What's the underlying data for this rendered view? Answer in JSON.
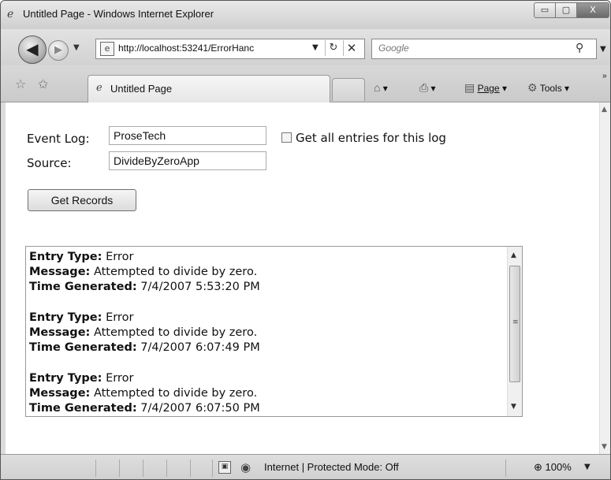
{
  "window": {
    "title": "Untitled Page - Windows Internet Explorer",
    "min_glyph": "▭",
    "max_glyph": "▢",
    "close_glyph": "X"
  },
  "nav": {
    "back_glyph": "◀",
    "forward_glyph": "▶",
    "address": "http://localhost:53241/ErrorHanc",
    "search_placeholder": "Google"
  },
  "tabs": {
    "active_label": "Untitled Page"
  },
  "commands": {
    "page_label": "Page",
    "tools_label": "Tools",
    "more_glyph": "»"
  },
  "form": {
    "event_log_label": "Event Log:",
    "event_log_value": "ProseTech",
    "source_label": "Source:",
    "source_value": "DivideByZeroApp",
    "get_all_label": "Get all entries for this log",
    "get_all_checked": false,
    "button_label": "Get Records"
  },
  "entries": [
    {
      "type_label": "Entry Type:",
      "type": "Error",
      "message_label": "Message:",
      "message": "Attempted to divide by zero.",
      "time_label": "Time Generated:",
      "time": "7/4/2007 5:53:20 PM"
    },
    {
      "type_label": "Entry Type:",
      "type": "Error",
      "message_label": "Message:",
      "message": "Attempted to divide by zero.",
      "time_label": "Time Generated:",
      "time": "7/4/2007 6:07:49 PM"
    },
    {
      "type_label": "Entry Type:",
      "type": "Error",
      "message_label": "Message:",
      "message": "Attempted to divide by zero.",
      "time_label": "Time Generated:",
      "time": "7/4/2007 6:07:50 PM"
    }
  ],
  "status": {
    "zone": "Internet | Protected Mode: Off",
    "zoom": "100%"
  },
  "icons": {
    "ie": "ie-logo-icon",
    "refresh": "refresh-icon",
    "stop": "stop-icon",
    "search": "search-icon",
    "home": "home-icon",
    "print": "print-icon",
    "page": "page-icon",
    "tools": "gear-icon",
    "favorites": "star-icon",
    "add_favorite": "add-favorite-icon",
    "globe": "globe-icon",
    "zoom": "magnifier-icon"
  }
}
